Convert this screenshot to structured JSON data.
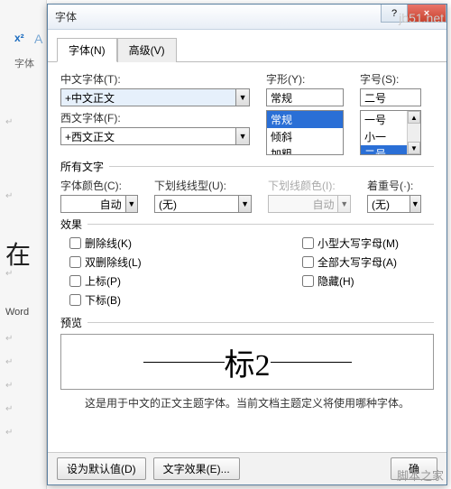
{
  "watermark_top": "jb51.net",
  "watermark_bottom": "脚本之家",
  "background": {
    "x2": "x²",
    "a": "A",
    "font_label": "字体",
    "doc_text": "在",
    "word": "Word",
    "mark": "↵"
  },
  "dialog": {
    "title": "字体",
    "help": "?",
    "close": "×",
    "tabs": {
      "font": "字体(N)",
      "adv": "高级(V)"
    },
    "labels": {
      "chinese_font": "中文字体(T):",
      "western_font": "西文字体(F):",
      "font_style": "字形(Y):",
      "font_size": "字号(S):",
      "all_text": "所有文字",
      "font_color": "字体颜色(C):",
      "underline": "下划线线型(U):",
      "underline_color": "下划线颜色(I):",
      "emphasis": "着重号(·):",
      "effects": "效果",
      "preview": "预览"
    },
    "values": {
      "chinese_font": "+中文正文",
      "western_font": "+西文正文",
      "font_style": "常规",
      "font_size": "二号",
      "font_color": "自动",
      "underline": "(无)",
      "underline_color": "自动",
      "emphasis": "(无)"
    },
    "style_options": [
      "常规",
      "倾斜",
      "加粗"
    ],
    "size_options": [
      "一号",
      "小一",
      "二号"
    ],
    "checks": {
      "strike": "删除线(K)",
      "dstrike": "双删除线(L)",
      "superscript": "上标(P)",
      "subscript": "下标(B)",
      "smallcaps": "小型大写字母(M)",
      "allcaps": "全部大写字母(A)",
      "hidden": "隐藏(H)"
    },
    "preview_sample": "标2",
    "note": "这是用于中文的正文主题字体。当前文档主题定义将使用哪种字体。",
    "buttons": {
      "default": "设为默认值(D)",
      "text_effects": "文字效果(E)...",
      "ok": "确"
    }
  }
}
